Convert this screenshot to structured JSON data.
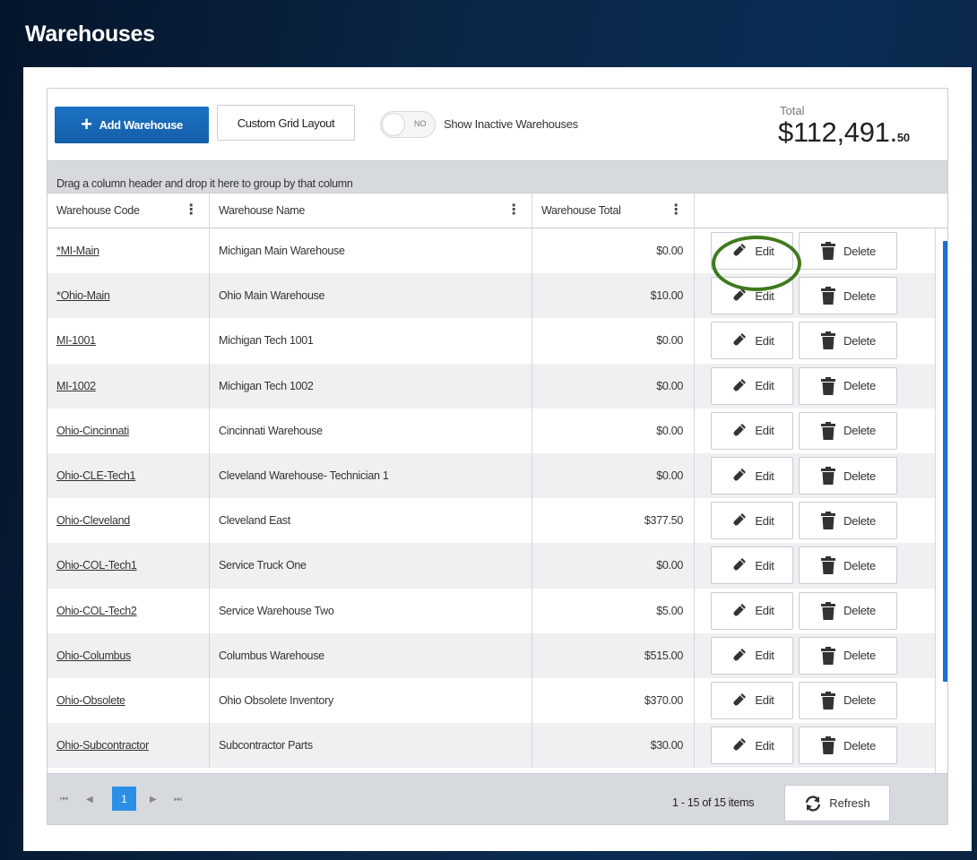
{
  "page": {
    "title": "Warehouses"
  },
  "toolbar": {
    "add_label": "Add Warehouse",
    "custom_grid_label": "Custom Grid Layout",
    "toggle_state": "NO",
    "toggle_label": "Show Inactive Warehouses",
    "total_label": "Total",
    "total_main": "$112,491.",
    "total_cents": "50"
  },
  "group_bar": {
    "text": "Drag a column header and drop it here to group by that column"
  },
  "columns": [
    "Warehouse Code",
    "Warehouse Name",
    "Warehouse Total",
    ""
  ],
  "rows": [
    {
      "code": "*MI-Main",
      "name": "Michigan Main Warehouse",
      "total": "$0.00"
    },
    {
      "code": "*Ohio-Main",
      "name": "Ohio Main Warehouse",
      "total": "$10.00"
    },
    {
      "code": "MI-1001",
      "name": "Michigan Tech 1001",
      "total": "$0.00"
    },
    {
      "code": "MI-1002",
      "name": "Michigan Tech 1002",
      "total": "$0.00"
    },
    {
      "code": "Ohio-Cincinnati",
      "name": "Cincinnati Warehouse",
      "total": "$0.00"
    },
    {
      "code": "Ohio-CLE-Tech1",
      "name": "Cleveland Warehouse- Technician 1",
      "total": "$0.00"
    },
    {
      "code": "Ohio-Cleveland",
      "name": "Cleveland East",
      "total": "$377.50"
    },
    {
      "code": "Ohio-COL-Tech1",
      "name": "Service Truck One",
      "total": "$0.00"
    },
    {
      "code": "Ohio-COL-Tech2",
      "name": "Service Warehouse Two",
      "total": "$5.00"
    },
    {
      "code": "Ohio-Columbus",
      "name": "Columbus Warehouse",
      "total": "$515.00"
    },
    {
      "code": "Ohio-Obsolete",
      "name": "Ohio Obsolete Inventory",
      "total": "$370.00"
    },
    {
      "code": "Ohio-Subcontractor",
      "name": "Subcontractor Parts",
      "total": "$30.00"
    }
  ],
  "row_actions": {
    "edit_label": "Edit",
    "delete_label": "Delete"
  },
  "pager": {
    "current_page": "1",
    "items_info": "1 - 15 of 15 items",
    "refresh_label": "Refresh"
  },
  "colors": {
    "accent": "#1d72c4",
    "page_active": "#2b8fe6",
    "highlight": "#3f7a1d",
    "scroll_thumb": "#1c6fd1"
  },
  "icons": {
    "add": "plus-icon",
    "edit": "pencil-icon",
    "delete": "trash-icon",
    "refresh": "refresh-icon"
  }
}
